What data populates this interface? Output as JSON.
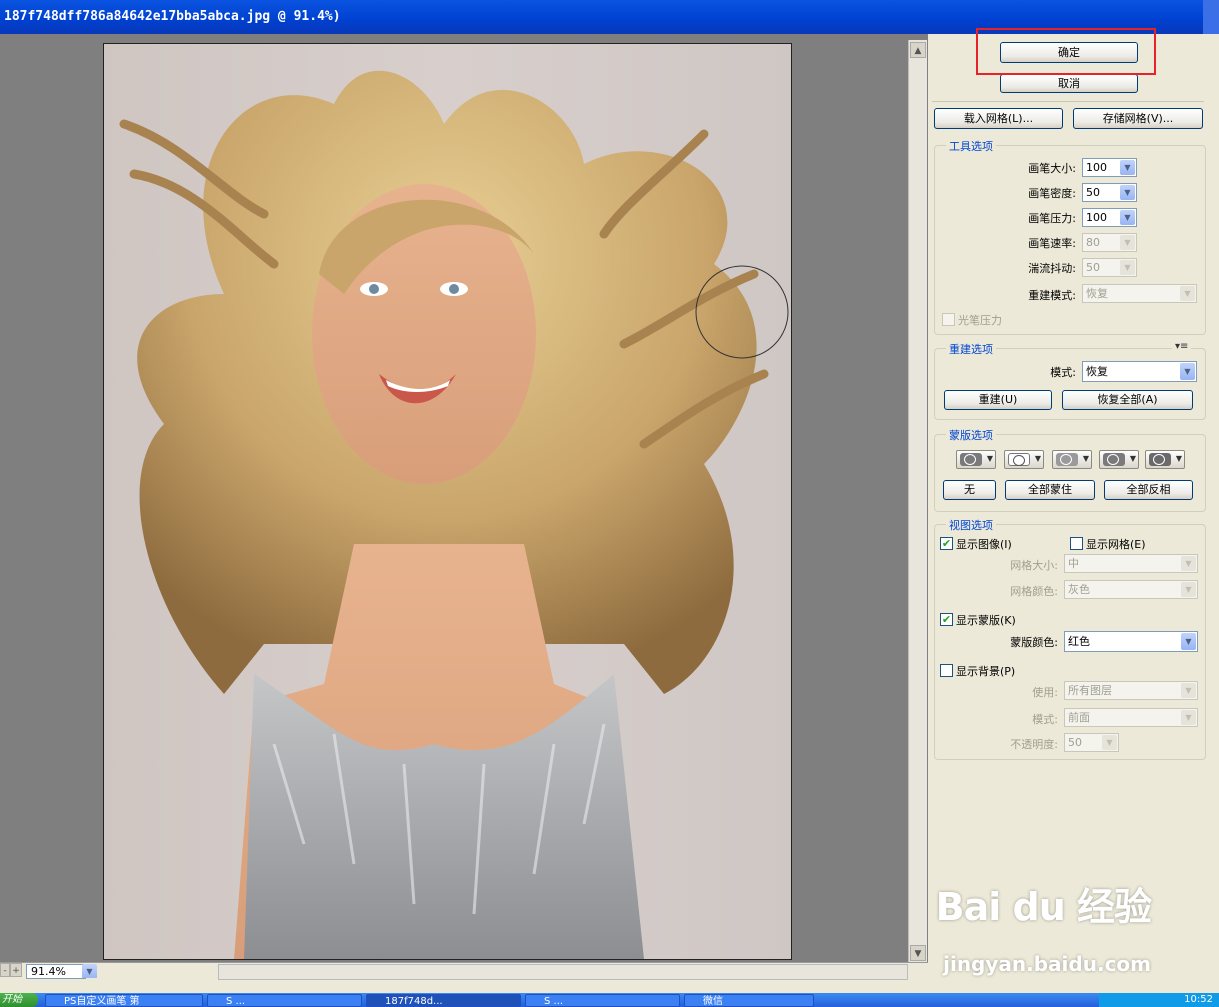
{
  "window": {
    "title": "187f748dff786a84642e17bba5abca.jpg @ 91.4%)"
  },
  "status": {
    "zoom": "91.4%",
    "minus": "-",
    "plus": "+"
  },
  "panel": {
    "ok": "确定",
    "cancel": "取消",
    "load_mesh": "载入网格(L)...",
    "save_mesh": "存储网格(V)...",
    "tool_options": {
      "title": "工具选项",
      "brush_size": {
        "label": "画笔大小:",
        "value": "100"
      },
      "brush_density": {
        "label": "画笔密度:",
        "value": "50"
      },
      "brush_pressure": {
        "label": "画笔压力:",
        "value": "100"
      },
      "brush_rate": {
        "label": "画笔速率:",
        "value": "80"
      },
      "turbulent_jitter": {
        "label": "湍流抖动:",
        "value": "50"
      },
      "reconstruct_mode": {
        "label": "重建模式:",
        "value": "恢复"
      },
      "stylus_pressure": "光笔压力"
    },
    "reconstruct_options": {
      "title": "重建选项",
      "mode": {
        "label": "模式:",
        "value": "恢复"
      },
      "reconstruct": "重建(U)",
      "restore_all": "恢复全部(A)"
    },
    "mask_options": {
      "title": "蒙版选项",
      "none": "无",
      "mask_all": "全部蒙住",
      "invert_all": "全部反相"
    },
    "view_options": {
      "title": "视图选项",
      "show_image": {
        "label": "显示图像(I)",
        "checked": true
      },
      "show_mesh": {
        "label": "显示网格(E)",
        "checked": false
      },
      "mesh_size": {
        "label": "网格大小:",
        "value": "中"
      },
      "mesh_color": {
        "label": "网格颜色:",
        "value": "灰色"
      },
      "show_mask": {
        "label": "显示蒙版(K)",
        "checked": true
      },
      "mask_color": {
        "label": "蒙版颜色:",
        "value": "红色"
      },
      "show_backdrop": {
        "label": "显示背景(P)",
        "checked": false
      },
      "use": {
        "label": "使用:",
        "value": "所有图层"
      },
      "mode": {
        "label": "模式:",
        "value": "前面"
      },
      "opacity": {
        "label": "不透明度:",
        "value": "50"
      }
    }
  },
  "taskbar": {
    "start": "开始",
    "items": [
      "PS自定义画笔 第",
      "S ... ",
      "187f748d...",
      "S ... ",
      "微信"
    ],
    "clock": "10:52"
  },
  "watermark": {
    "logo": "Bai du 经验",
    "url": "jingyan.baidu.com"
  },
  "colors": {
    "highlight": "#E8222A",
    "group_title": "#0046D5",
    "title_bar": "#0A54E0"
  }
}
